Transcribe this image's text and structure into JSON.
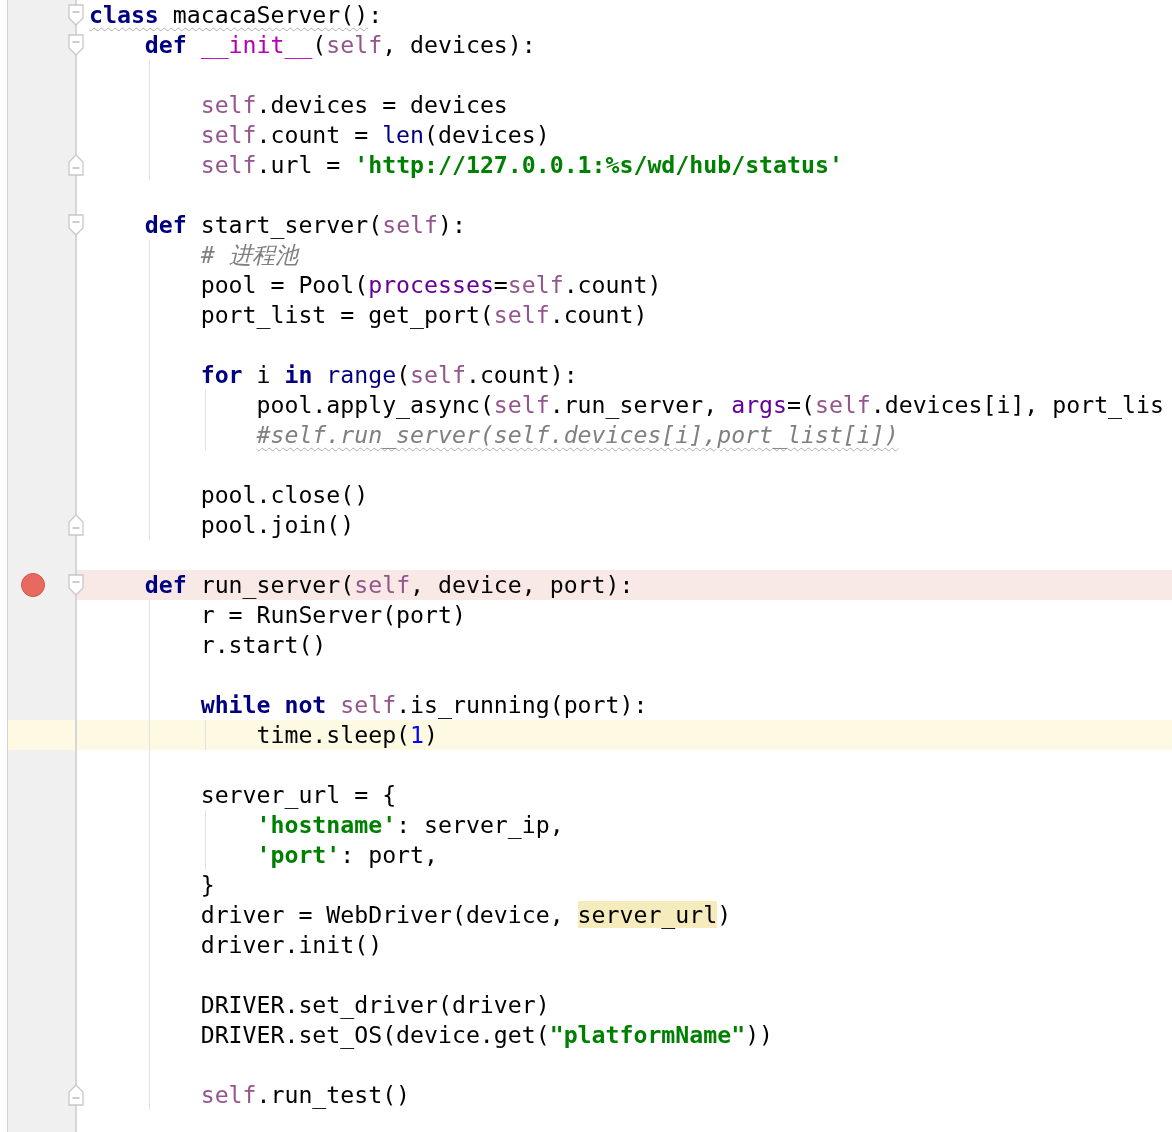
{
  "lines": [
    {
      "fold_start": true,
      "breakpoint": false,
      "current": false,
      "tokens": [
        {
          "text": "class",
          "kind": "keyword",
          "warning": true
        },
        {
          "text": " macacaServer()",
          "kind": "plain",
          "warning": true
        },
        {
          "text": ":",
          "kind": "plain"
        }
      ],
      "children": [
        {
          "fold_start": true,
          "breakpoint": false,
          "current": false,
          "tokens": [
            {
              "text": "def",
              "kind": "keyword"
            },
            {
              "text": " __init__",
              "kind": "magic"
            },
            {
              "text": "(",
              "kind": "plain"
            },
            {
              "text": "self",
              "kind": "self"
            },
            {
              "text": ", devices):",
              "kind": "plain"
            }
          ],
          "children": [
            {
              "breakpoint": false,
              "current": false
            },
            {
              "breakpoint": false,
              "current": false,
              "tokens": [
                {
                  "text": "self",
                  "kind": "self"
                },
                {
                  "text": ".devices = devices",
                  "kind": "plain"
                }
              ]
            },
            {
              "breakpoint": false,
              "current": false,
              "tokens": [
                {
                  "text": "self",
                  "kind": "self"
                },
                {
                  "text": ".count = ",
                  "kind": "plain"
                },
                {
                  "text": "len",
                  "kind": "builtin"
                },
                {
                  "text": "(devices)",
                  "kind": "plain"
                }
              ]
            },
            {
              "fold_end": true,
              "breakpoint": false,
              "current": false,
              "tokens": [
                {
                  "text": "self",
                  "kind": "self"
                },
                {
                  "text": ".url = ",
                  "kind": "plain"
                },
                {
                  "text": "'http://127.0.0.1:%s/wd/hub/status'",
                  "kind": "string"
                }
              ]
            }
          ]
        },
        {
          "breakpoint": false,
          "current": false
        },
        {
          "fold_start": true,
          "breakpoint": false,
          "current": false,
          "tokens": [
            {
              "text": "def",
              "kind": "keyword"
            },
            {
              "text": " start_server(",
              "kind": "plain"
            },
            {
              "text": "self",
              "kind": "self"
            },
            {
              "text": "):",
              "kind": "plain"
            }
          ],
          "children": [
            {
              "breakpoint": false,
              "current": false,
              "tokens": [
                {
                  "text": "# 进程池",
                  "kind": "comment"
                }
              ]
            },
            {
              "breakpoint": false,
              "current": false,
              "tokens": [
                {
                  "text": "pool = Pool(",
                  "kind": "plain"
                },
                {
                  "text": "processes",
                  "kind": "param"
                },
                {
                  "text": "=",
                  "kind": "plain"
                },
                {
                  "text": "self",
                  "kind": "self"
                },
                {
                  "text": ".count)",
                  "kind": "plain"
                }
              ]
            },
            {
              "breakpoint": false,
              "current": false,
              "tokens": [
                {
                  "text": "port_list = get_port(",
                  "kind": "plain"
                },
                {
                  "text": "self",
                  "kind": "self"
                },
                {
                  "text": ".count)",
                  "kind": "plain"
                }
              ]
            },
            {
              "breakpoint": false,
              "current": false
            },
            {
              "breakpoint": false,
              "current": false,
              "tokens": [
                {
                  "text": "for",
                  "kind": "keyword"
                },
                {
                  "text": " i ",
                  "kind": "plain"
                },
                {
                  "text": "in",
                  "kind": "keyword"
                },
                {
                  "text": " range",
                  "kind": "builtin"
                },
                {
                  "text": "(",
                  "kind": "plain"
                },
                {
                  "text": "self",
                  "kind": "self"
                },
                {
                  "text": ".count):",
                  "kind": "plain"
                }
              ],
              "children": [
                {
                  "breakpoint": false,
                  "current": false,
                  "tokens": [
                    {
                      "text": "pool.apply_async(",
                      "kind": "plain"
                    },
                    {
                      "text": "self",
                      "kind": "self"
                    },
                    {
                      "text": ".run_server, ",
                      "kind": "plain"
                    },
                    {
                      "text": "args",
                      "kind": "param"
                    },
                    {
                      "text": "=(",
                      "kind": "plain"
                    },
                    {
                      "text": "self",
                      "kind": "self"
                    },
                    {
                      "text": ".devices[i], port_lis",
                      "kind": "plain"
                    }
                  ]
                },
                {
                  "breakpoint": false,
                  "current": false,
                  "tokens": [
                    {
                      "text": "#self.run_server(self.devices[i],port_list[i])",
                      "kind": "comment",
                      "warning": true
                    }
                  ]
                }
              ]
            },
            {
              "breakpoint": false,
              "current": false
            },
            {
              "breakpoint": false,
              "current": false,
              "tokens": [
                {
                  "text": "pool.close()",
                  "kind": "plain"
                }
              ]
            },
            {
              "fold_end": true,
              "breakpoint": false,
              "current": false,
              "tokens": [
                {
                  "text": "pool.join()",
                  "kind": "plain"
                }
              ]
            }
          ]
        },
        {
          "breakpoint": false,
          "current": false
        },
        {
          "fold_start": true,
          "breakpoint": true,
          "current": false,
          "tokens": [
            {
              "text": "def",
              "kind": "keyword"
            },
            {
              "text": " run_server(",
              "kind": "plain"
            },
            {
              "text": "self",
              "kind": "self"
            },
            {
              "text": ", device, port):",
              "kind": "plain"
            }
          ],
          "children": [
            {
              "breakpoint": false,
              "current": false,
              "tokens": [
                {
                  "text": "r = RunServer(port)",
                  "kind": "plain"
                }
              ]
            },
            {
              "breakpoint": false,
              "current": false,
              "tokens": [
                {
                  "text": "r.start()",
                  "kind": "plain"
                }
              ]
            },
            {
              "breakpoint": false,
              "current": false
            },
            {
              "breakpoint": false,
              "current": false,
              "tokens": [
                {
                  "text": "while",
                  "kind": "keyword"
                },
                {
                  "text": " not",
                  "kind": "keyword"
                },
                {
                  "text": " self",
                  "kind": "self"
                },
                {
                  "text": ".is_running(port):",
                  "kind": "plain"
                }
              ],
              "children": [
                {
                  "breakpoint": false,
                  "current": true,
                  "tokens": [
                    {
                      "text": "time.sleep(",
                      "kind": "plain"
                    },
                    {
                      "text": "1",
                      "kind": "number"
                    },
                    {
                      "text": ")",
                      "kind": "plain"
                    }
                  ]
                }
              ]
            },
            {
              "breakpoint": false,
              "current": false
            },
            {
              "breakpoint": false,
              "current": false,
              "tokens": [
                {
                  "text": "server_url = {",
                  "kind": "plain"
                }
              ],
              "children": [
                {
                  "breakpoint": false,
                  "current": false,
                  "tokens": [
                    {
                      "text": "'hostname'",
                      "kind": "string"
                    },
                    {
                      "text": ": server_ip,",
                      "kind": "plain"
                    }
                  ]
                },
                {
                  "breakpoint": false,
                  "current": false,
                  "tokens": [
                    {
                      "text": "'port'",
                      "kind": "string"
                    },
                    {
                      "text": ": port,",
                      "kind": "plain"
                    }
                  ]
                }
              ]
            },
            {
              "breakpoint": false,
              "current": false,
              "tokens": [
                {
                  "text": "}",
                  "kind": "plain"
                }
              ]
            },
            {
              "breakpoint": false,
              "current": false,
              "tokens": [
                {
                  "text": "driver = WebDriver(device, ",
                  "kind": "plain"
                },
                {
                  "text": "server_url",
                  "kind": "plain",
                  "usage": true
                },
                {
                  "text": ")",
                  "kind": "plain"
                }
              ]
            },
            {
              "breakpoint": false,
              "current": false,
              "tokens": [
                {
                  "text": "driver.init()",
                  "kind": "plain"
                }
              ]
            },
            {
              "breakpoint": false,
              "current": false
            },
            {
              "breakpoint": false,
              "current": false,
              "tokens": [
                {
                  "text": "DRIVER.set_driver(driver)",
                  "kind": "plain"
                }
              ]
            },
            {
              "breakpoint": false,
              "current": false,
              "tokens": [
                {
                  "text": "DRIVER.set_OS(device.get(",
                  "kind": "plain"
                },
                {
                  "text": "\"platformName\"",
                  "kind": "string"
                },
                {
                  "text": "))",
                  "kind": "plain"
                }
              ]
            },
            {
              "breakpoint": false,
              "current": false
            },
            {
              "fold_end": true,
              "breakpoint": false,
              "current": false,
              "tokens": [
                {
                  "text": "self",
                  "kind": "self"
                },
                {
                  "text": ".run_test()",
                  "kind": "plain"
                }
              ]
            }
          ]
        }
      ]
    }
  ]
}
